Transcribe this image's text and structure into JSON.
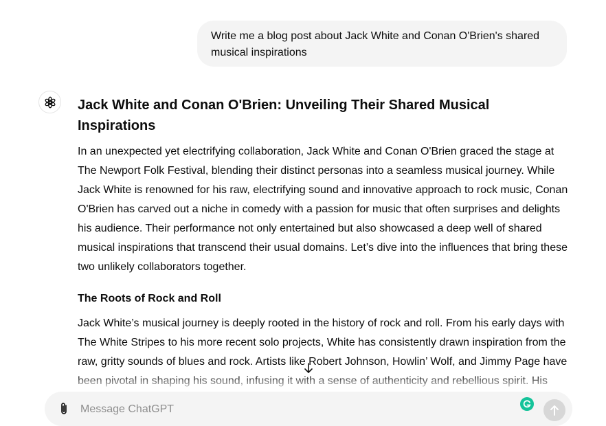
{
  "user_message": {
    "text": "Write me a blog post about Jack White and Conan O'Brien's shared musical inspirations"
  },
  "assistant": {
    "avatar_icon": "chatgpt-logo-icon",
    "title": "Jack White and Conan O'Brien: Unveiling Their Shared Musical Inspirations",
    "intro": "In an unexpected yet electrifying collaboration, Jack White and Conan O'Brien graced the stage at The Newport Folk Festival, blending their distinct personas into a seamless musical journey. While Jack White is renowned for his raw, electrifying sound and innovative approach to rock music, Conan O'Brien has carved out a niche in comedy with a passion for music that often surprises and delights his audience. Their performance not only entertained but also showcased a deep well of shared musical inspirations that transcend their usual domains. Let’s dive into the influences that bring these two unlikely collaborators together.",
    "section_heading": "The Roots of Rock and Roll",
    "section_body": "Jack White’s musical journey is deeply rooted in the history of rock and roll. From his early days with The White Stripes to his more recent solo projects, White has consistently drawn inspiration from the raw, gritty sounds of blues and rock. Artists like Robert Johnson, Howlin’ Wolf, and Jimmy Page have been pivotal in shaping his sound, infusing it with a sense of authenticity and rebellious spirit. His minimalist approach, characterized by stark, powerful guitar riffs and a penchant for analog recording techniques, pays homage to the pioneers of rock and roll."
  },
  "composer": {
    "placeholder": "Message ChatGPT",
    "value": "",
    "attach_icon": "paperclip-icon",
    "grammarly_icon": "grammarly-icon",
    "send_icon": "arrow-up-icon"
  },
  "scroll_icon": "arrow-down-icon",
  "colors": {
    "bubble_bg": "#f4f4f4",
    "composer_bg": "#f4f4f4",
    "grammarly": "#15c39a",
    "send_disabled": "#d7d7d7",
    "text": "#0d0d0d",
    "placeholder": "#8e8e8e"
  }
}
